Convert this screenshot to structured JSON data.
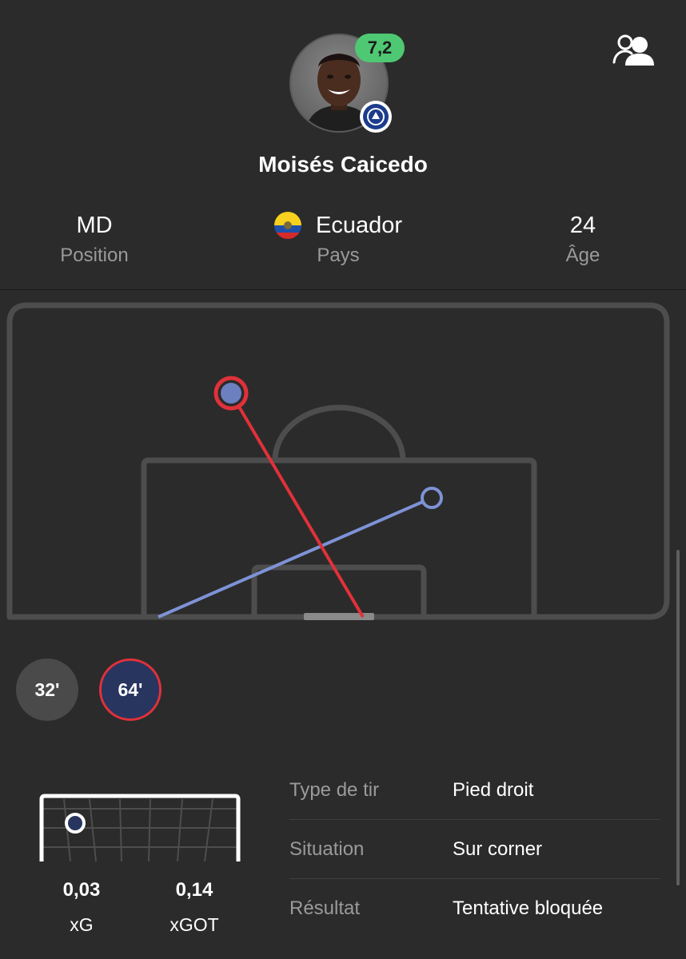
{
  "player": {
    "name": "Moisés Caicedo",
    "rating": "7,2"
  },
  "info": {
    "position": {
      "value": "MD",
      "label": "Position"
    },
    "country": {
      "value": "Ecuador",
      "label": "Pays"
    },
    "age": {
      "value": "24",
      "label": "Âge"
    }
  },
  "shots": [
    {
      "minute": "32'",
      "selected": false
    },
    {
      "minute": "64'",
      "selected": true
    }
  ],
  "shot_stats": {
    "xg": {
      "value": "0,03",
      "label": "xG"
    },
    "xgot": {
      "value": "0,14",
      "label": "xGOT"
    }
  },
  "shot_details": [
    {
      "key": "Type de tir",
      "value": "Pied droit"
    },
    {
      "key": "Situation",
      "value": "Sur corner"
    },
    {
      "key": "Résultat",
      "value": "Tentative bloquée"
    }
  ],
  "colors": {
    "background": "#2b2b2b",
    "rating_green": "#4fc873",
    "selected_shot_red": "#e0313a",
    "other_shot_blue": "#7e92d6",
    "selected_chip_fill": "#27355f"
  },
  "icons": {
    "compare": "people-compare-icon",
    "club": "chelsea-crest-icon",
    "flag": "ecuador-flag-icon"
  }
}
